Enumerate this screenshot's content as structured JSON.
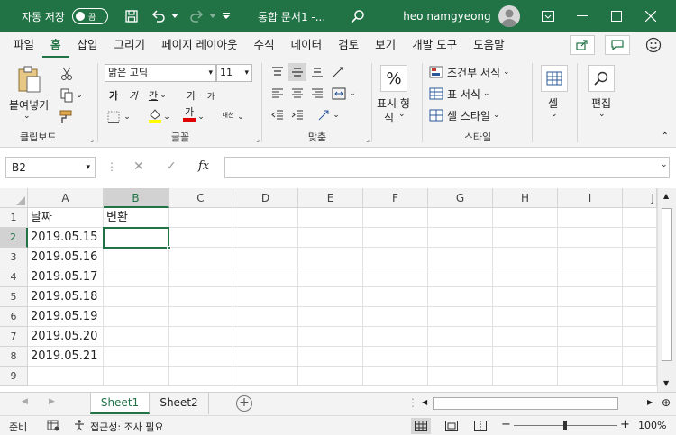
{
  "titlebar": {
    "autosave_label": "자동 저장",
    "autosave_state": "끔",
    "doc_title": "통합 문서1  -...",
    "user_name": "heo namgyeong"
  },
  "menu": {
    "tabs": [
      "파일",
      "홈",
      "삽입",
      "그리기",
      "페이지 레이아웃",
      "수식",
      "데이터",
      "검토",
      "보기",
      "개발 도구",
      "도움말"
    ]
  },
  "ribbon": {
    "clipboard": {
      "paste_label_1": "붙여넣기",
      "paste_label_2": "",
      "group_label": "클립보드"
    },
    "font": {
      "font_name": "맑은 고딕",
      "font_size": "11",
      "bold": "가",
      "italic": "가",
      "underline": "간",
      "grow": "가",
      "shrink": "가",
      "color_a": "가",
      "phonetic": "내천",
      "group_label": "글꼴"
    },
    "alignment": {
      "group_label": "맞춤"
    },
    "number": {
      "label_1": "표시 형",
      "label_2": "식",
      "pct": "%"
    },
    "styles": {
      "conditional": "조건부 서식",
      "table": "표 서식",
      "cell_style": "셀 스타일",
      "group_label": "스타일"
    },
    "cells": {
      "label": "셀"
    },
    "editing": {
      "label": "편집"
    }
  },
  "formula": {
    "name_box": "B2",
    "fx": "fx",
    "value": ""
  },
  "grid": {
    "columns": [
      "A",
      "B",
      "C",
      "D",
      "E",
      "F",
      "G",
      "H",
      "I",
      "J"
    ],
    "rows": [
      "1",
      "2",
      "3",
      "4",
      "5",
      "6",
      "7",
      "8",
      "9"
    ],
    "cells": {
      "A1": "날짜",
      "B1": "변환",
      "A2": "2019.05.15",
      "A3": "2019.05.16",
      "A4": "2019.05.17",
      "A5": "2019.05.18",
      "A6": "2019.05.19",
      "A7": "2019.05.20",
      "A8": "2019.05.21"
    },
    "selected": "B2"
  },
  "sheets": {
    "tabs": [
      "Sheet1",
      "Sheet2"
    ],
    "active": "Sheet1",
    "add": "+"
  },
  "status": {
    "mode": "준비",
    "accessibility": "접근성: 조사 필요",
    "zoom": "100%"
  },
  "colors": {
    "accent": "#217346"
  }
}
